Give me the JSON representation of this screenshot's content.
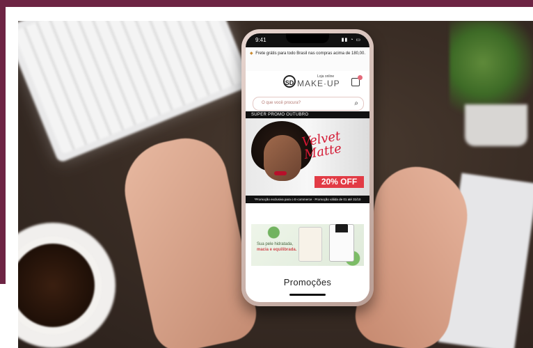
{
  "colors": {
    "frame": "#6d2443",
    "promo_red": "#e23b45",
    "script_red": "#d31732"
  },
  "phone": {
    "status": {
      "time": "9:41",
      "icons": "▮▮ ◔ ▭"
    },
    "shipping_banner": "Frete grátis para todo Brasil nas compras acima de 180,00.",
    "store": {
      "sub_label": "Loja online",
      "logo_text": "MAKE·UP",
      "logo_mark": "SD"
    },
    "search": {
      "placeholder": "O que você procura?"
    },
    "promo": {
      "title": "SUPER PROMO OUTUBRO",
      "script": "Velvet Matte",
      "discount": "20% OFF",
      "footer": "*Promoção exclusiva para o E-commerce · Promoção válida de 01 até 31/10"
    },
    "product_banner": {
      "line1": "Sua pele hidratada,",
      "line2": "macia e equilibrada."
    },
    "section_heading": "Promoções"
  }
}
